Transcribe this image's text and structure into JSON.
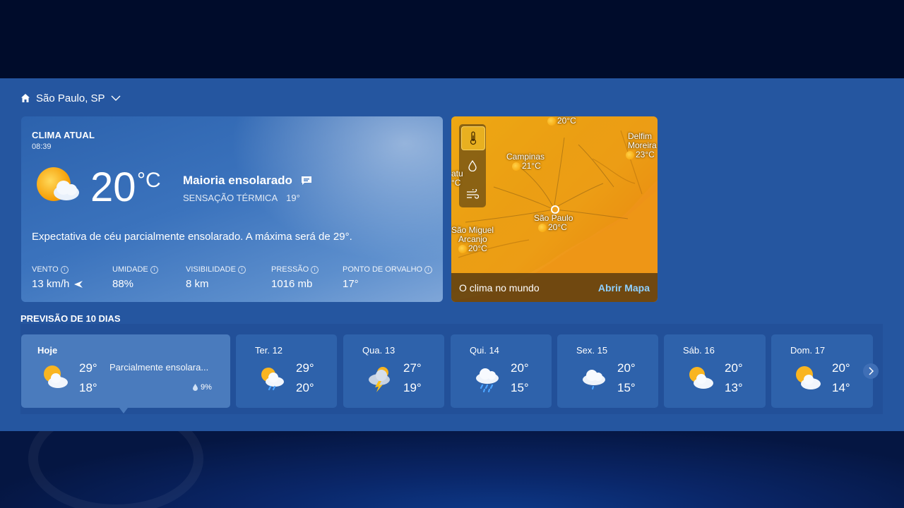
{
  "location": {
    "label": "São Paulo, SP"
  },
  "current": {
    "title": "CLIMA ATUAL",
    "time": "08:39",
    "temp": "20",
    "unit": "°C",
    "condition": "Maioria ensolarado",
    "feels_label": "SENSAÇÃO TÉRMICA",
    "feels_value": "19°",
    "expectation": "Expectativa de céu parcialmente ensolarado. A máxima será de 29°.",
    "metrics": [
      {
        "label": "VENTO",
        "value": "13 km/h"
      },
      {
        "label": "UMIDADE",
        "value": "88%"
      },
      {
        "label": "VISIBILIDADE",
        "value": "8 km"
      },
      {
        "label": "PRESSÃO",
        "value": "1016 mb"
      },
      {
        "label": "PONTO DE ORVALHO",
        "value": "17°"
      }
    ]
  },
  "map": {
    "cities": [
      {
        "name": "",
        "temp": "20°C"
      },
      {
        "name": "Delfim Moreira",
        "name1": "Delfim",
        "name2": "Moreira",
        "temp": "23°C"
      },
      {
        "name": "Campinas",
        "temp": "21°C"
      },
      {
        "name": "São Paulo",
        "temp": "20°C"
      },
      {
        "name": "São Miguel Arcanjo",
        "name1": "São Miguel",
        "name2": "Arcanjo",
        "temp": "20°C"
      }
    ],
    "edge_text1": "atu",
    "edge_text2": "°C",
    "footer_text": "O clima no mundo",
    "footer_link": "Abrir Mapa",
    "layers": [
      "thermometer-icon",
      "droplet-icon",
      "wind-icon"
    ]
  },
  "forecast": {
    "title": "PREVISÃO DE 10 DIAS",
    "days": [
      {
        "name": "Hoje",
        "hi": "29°",
        "lo": "18°",
        "icon": "partly-sunny-icon",
        "summary": "Parcialmente ensolara...",
        "precip": "9%"
      },
      {
        "name": "Ter. 12",
        "hi": "29°",
        "lo": "20°",
        "icon": "partly-sunny-rain-icon"
      },
      {
        "name": "Qua. 13",
        "hi": "27°",
        "lo": "19°",
        "icon": "thunderstorm-icon"
      },
      {
        "name": "Qui. 14",
        "hi": "20°",
        "lo": "15°",
        "icon": "rain-icon"
      },
      {
        "name": "Sex. 15",
        "hi": "20°",
        "lo": "15°",
        "icon": "light-rain-icon"
      },
      {
        "name": "Sáb. 16",
        "hi": "20°",
        "lo": "13°",
        "icon": "partly-sunny-icon"
      },
      {
        "name": "Dom. 17",
        "hi": "20°",
        "lo": "14°",
        "icon": "partly-sunny-icon"
      }
    ]
  },
  "colors": {
    "panel": "#2556a0",
    "card": "#2e62ab",
    "today": "#4a7bbd",
    "map_link": "#8fd0ff"
  }
}
